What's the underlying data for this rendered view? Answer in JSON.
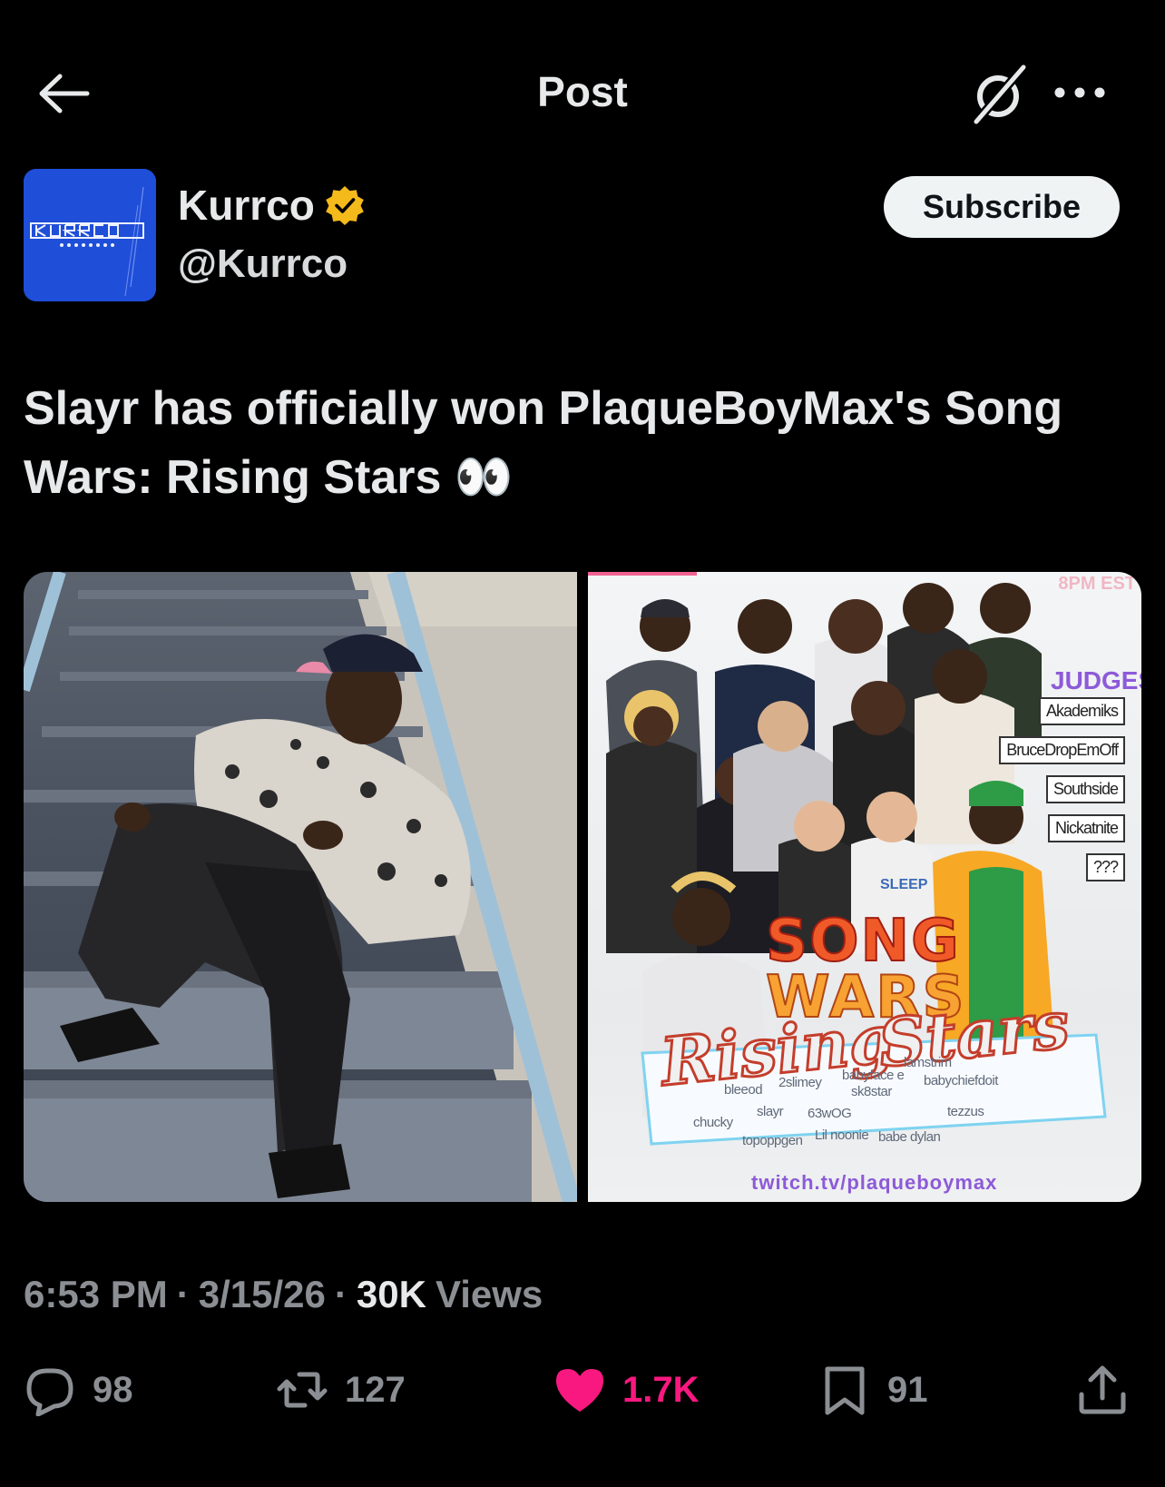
{
  "header": {
    "title": "Post",
    "back_icon": "arrow-left-icon",
    "grok_icon": "grok-icon",
    "more_icon": "more-horizontal-icon"
  },
  "author": {
    "name": "Kurrco",
    "handle": "@Kurrco",
    "verified": true,
    "verified_color": "#f4b91b",
    "avatar_color": "#1f4ed8",
    "avatar_logo_text": "KURRCO",
    "subscribe_label": "Subscribe"
  },
  "post": {
    "text": "Slayr has officially won PlaqueBoyMax's Song Wars: Rising Stars 👀",
    "media": {
      "poster": {
        "time_text": "8PM EST",
        "judges_title": "JUDGES:",
        "judges": [
          "Akademiks",
          "BruceDropEmOff",
          "Southside",
          "Nickatnite",
          "???"
        ],
        "sleep_tag": "SLEEP",
        "title_song": "SONG",
        "title_wars": "WARS",
        "title_rising": "Rising",
        "title_stars": "Stars",
        "contestants": [
          "bleeod",
          "2slimey",
          "babyface e",
          "lamstrim",
          "babychiefdoit",
          "sk8star",
          "chucky",
          "slayr",
          "63wOG",
          "tezzus",
          "topoppgen",
          "Lil noonie",
          "babe dylan"
        ],
        "twitch": "twitch.tv/plaqueboymax"
      }
    }
  },
  "meta": {
    "time": "6:53 PM",
    "sep1": "·",
    "date": "3/15/26",
    "sep2": "·",
    "views_count": "30K",
    "views_label": "Views"
  },
  "actions": {
    "replies": "98",
    "reposts": "127",
    "likes": "1.7K",
    "bookmarks": "91",
    "like_color": "#f91880"
  }
}
